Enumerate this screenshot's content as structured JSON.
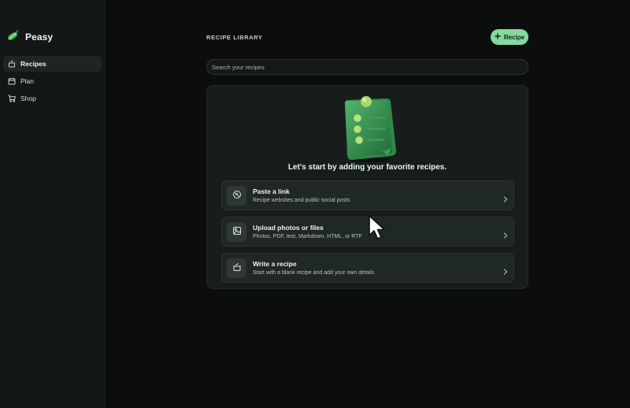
{
  "app": {
    "name": "Peasy"
  },
  "sidebar": {
    "items": [
      {
        "label": "Recipes",
        "icon": "pot-icon",
        "active": true
      },
      {
        "label": "Plan",
        "icon": "calendar-icon",
        "active": false
      },
      {
        "label": "Shop",
        "icon": "cart-icon",
        "active": false
      }
    ]
  },
  "header": {
    "title": "RECIPE LIBRARY",
    "add_button_label": "Recipe"
  },
  "search": {
    "placeholder": "Search your recipes",
    "value": ""
  },
  "empty_state": {
    "heading": "Let's start by adding your favorite recipes.",
    "illustration": "clipboard-illustration",
    "options": [
      {
        "title": "Paste a link",
        "subtitle": "Recipe websites and public social posts",
        "icon": "link-icon"
      },
      {
        "title": "Upload photos or files",
        "subtitle": "Photos, PDF, text, Markdown, HTML, or RTF",
        "icon": "image-icon"
      },
      {
        "title": "Write a recipe",
        "subtitle": "Start with a blank recipe and add your own details",
        "icon": "pot-icon"
      }
    ]
  },
  "colors": {
    "accent": "#86d8a0",
    "background": "#0b0e0d",
    "sidebar": "#131816",
    "card": "#171d1a",
    "option": "#202824"
  }
}
